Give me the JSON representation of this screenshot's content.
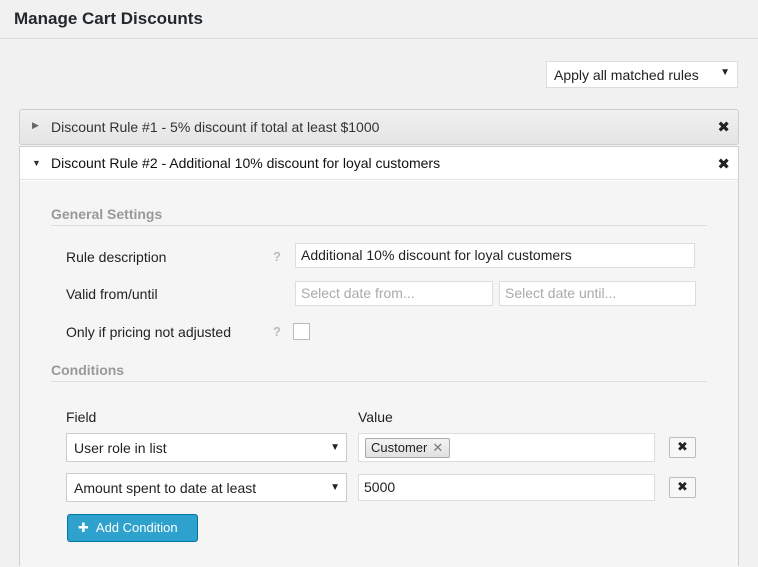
{
  "header": {
    "title": "Manage Cart Discounts"
  },
  "rules_selection": {
    "value": "Apply all matched rules"
  },
  "rule1": {
    "title": "Discount Rule #1 - 5% discount if total at least $1000"
  },
  "rule2": {
    "title": "Discount Rule #2 - Additional 10% discount for loyal customers",
    "general": {
      "section_title": "General Settings",
      "description_label": "Rule description",
      "description_value": "Additional 10% discount for loyal customers",
      "valid_label": "Valid from/until",
      "date_from_placeholder": "Select date from...",
      "date_until_placeholder": "Select date until...",
      "only_label": "Only if pricing not adjusted",
      "only_checked": false,
      "help_glyph": "?"
    },
    "conditions": {
      "section_title": "Conditions",
      "field_header": "Field",
      "value_header": "Value",
      "rows": [
        {
          "field": "User role in list",
          "tag": "Customer"
        },
        {
          "field": "Amount spent to date at least",
          "value": "5000"
        }
      ],
      "add_label": "Add Condition"
    }
  },
  "icons": {
    "collapsed": "triangle-right-icon",
    "expanded": "triangle-down-icon",
    "close": "close-icon",
    "dropdown": "chevron-down-icon",
    "plus": "plus-icon"
  },
  "colors": {
    "primary_button": "#2ea2cc",
    "primary_button_border": "#0074a2"
  }
}
